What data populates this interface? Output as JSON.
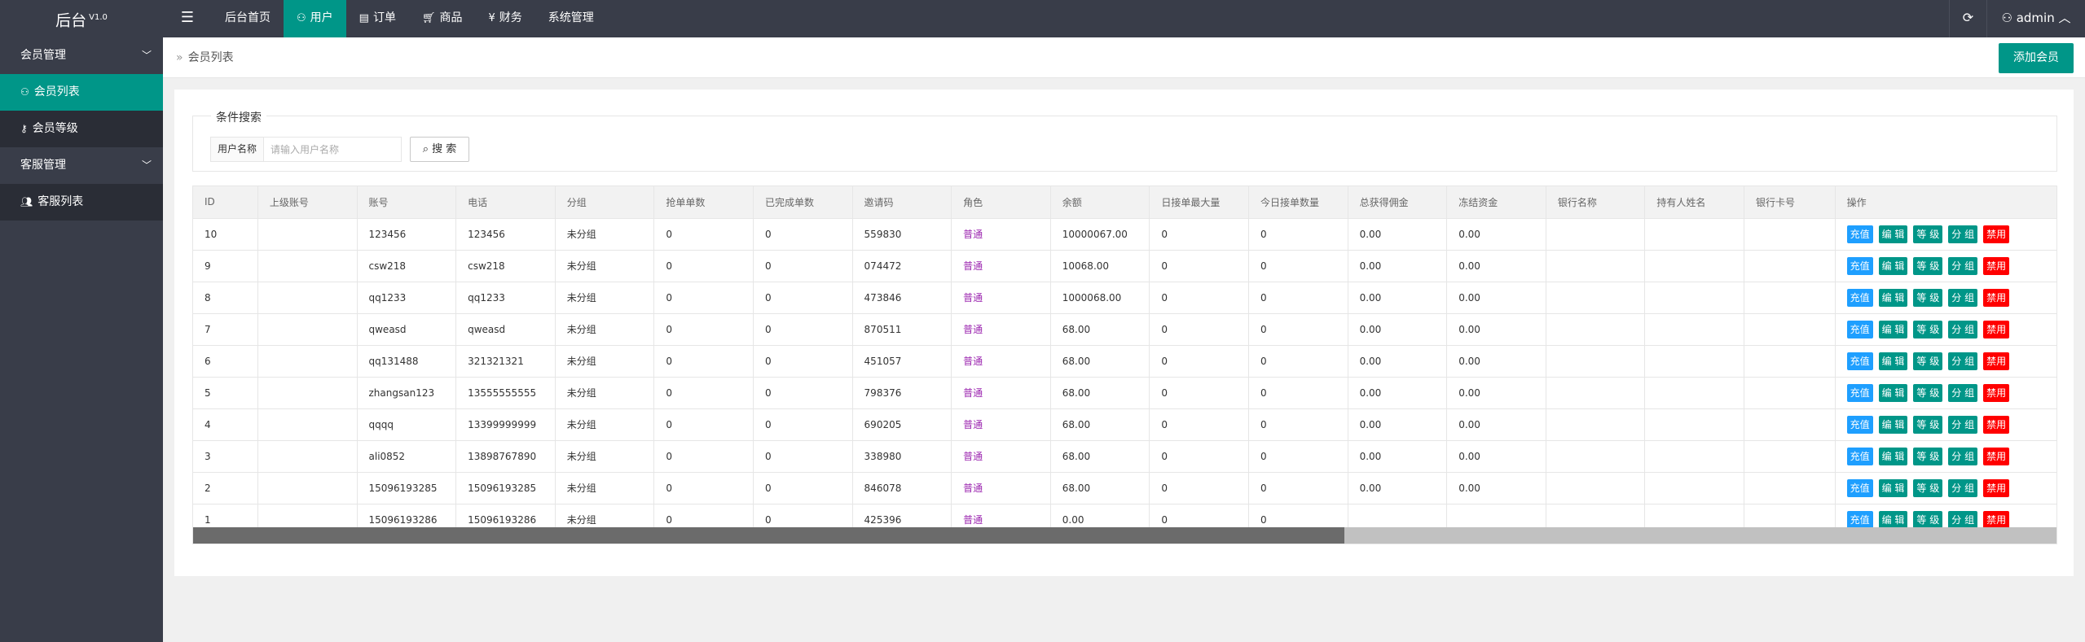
{
  "app": {
    "title": "后台",
    "version": "V1.0"
  },
  "topnav": [
    {
      "label": "后台首页",
      "icon": "",
      "active": false
    },
    {
      "label": "用户",
      "icon": "user-icon",
      "active": true
    },
    {
      "label": "订单",
      "icon": "document-icon",
      "active": false
    },
    {
      "label": "商品",
      "icon": "cart-icon",
      "active": false
    },
    {
      "label": "财务",
      "icon": "yen-icon",
      "active": false
    },
    {
      "label": "系统管理",
      "icon": "",
      "active": false
    }
  ],
  "topright": {
    "user": "admin"
  },
  "sidebar": {
    "groups": [
      {
        "label": "会员管理",
        "items": [
          {
            "label": "会员列表",
            "icon": "user-icon",
            "active": true
          },
          {
            "label": "会员等级",
            "icon": "key-icon",
            "active": false
          }
        ]
      },
      {
        "label": "客服管理",
        "items": [
          {
            "label": "客服列表",
            "icon": "users-icon",
            "active": false
          }
        ]
      }
    ]
  },
  "breadcrumb": {
    "sep": "»",
    "label": "会员列表"
  },
  "toolbar": {
    "add_label": "添加会员"
  },
  "search": {
    "legend": "条件搜索",
    "label": "用户名称",
    "placeholder": "请输入用户名称",
    "button": "搜 索"
  },
  "table": {
    "columns": [
      "ID",
      "上级账号",
      "账号",
      "电话",
      "分组",
      "抢单单数",
      "已完成单数",
      "邀请码",
      "角色",
      "余额",
      "日接单最大量",
      "今日接单数量",
      "总获得佣金",
      "冻结资金",
      "银行名称",
      "持有人姓名",
      "银行卡号",
      "操作"
    ],
    "rows": [
      [
        "10",
        "",
        "123456",
        "123456",
        "未分组",
        "0",
        "0",
        "559830",
        "普通",
        "10000067.00",
        "0",
        "0",
        "0.00",
        "0.00",
        "",
        "",
        ""
      ],
      [
        "9",
        "",
        "csw218",
        "csw218",
        "未分组",
        "0",
        "0",
        "074472",
        "普通",
        "10068.00",
        "0",
        "0",
        "0.00",
        "0.00",
        "",
        "",
        ""
      ],
      [
        "8",
        "",
        "qq1233",
        "qq1233",
        "未分组",
        "0",
        "0",
        "473846",
        "普通",
        "1000068.00",
        "0",
        "0",
        "0.00",
        "0.00",
        "",
        "",
        ""
      ],
      [
        "7",
        "",
        "qweasd",
        "qweasd",
        "未分组",
        "0",
        "0",
        "870511",
        "普通",
        "68.00",
        "0",
        "0",
        "0.00",
        "0.00",
        "",
        "",
        ""
      ],
      [
        "6",
        "",
        "qq131488",
        "321321321",
        "未分组",
        "0",
        "0",
        "451057",
        "普通",
        "68.00",
        "0",
        "0",
        "0.00",
        "0.00",
        "",
        "",
        ""
      ],
      [
        "5",
        "",
        "zhangsan123",
        "13555555555",
        "未分组",
        "0",
        "0",
        "798376",
        "普通",
        "68.00",
        "0",
        "0",
        "0.00",
        "0.00",
        "",
        "",
        ""
      ],
      [
        "4",
        "",
        "qqqq",
        "13399999999",
        "未分组",
        "0",
        "0",
        "690205",
        "普通",
        "68.00",
        "0",
        "0",
        "0.00",
        "0.00",
        "",
        "",
        ""
      ],
      [
        "3",
        "",
        "ali0852",
        "13898767890",
        "未分组",
        "0",
        "0",
        "338980",
        "普通",
        "68.00",
        "0",
        "0",
        "0.00",
        "0.00",
        "",
        "",
        ""
      ],
      [
        "2",
        "",
        "15096193285",
        "15096193285",
        "未分组",
        "0",
        "0",
        "846078",
        "普通",
        "68.00",
        "0",
        "0",
        "0.00",
        "0.00",
        "",
        "",
        ""
      ],
      [
        "1",
        "",
        "15096193286",
        "15096193286",
        "未分组",
        "0",
        "0",
        "425396",
        "普通",
        "0.00",
        "0",
        "0",
        "",
        "",
        "",
        "",
        ""
      ]
    ],
    "actions": [
      {
        "label": "充值",
        "name": "recharge",
        "color": "#1e9fff"
      },
      {
        "label": "编 辑",
        "name": "edit",
        "color": "#009688"
      },
      {
        "label": "等 级",
        "name": "level",
        "color": "#009688"
      },
      {
        "label": "分 组",
        "name": "group",
        "color": "#009688"
      },
      {
        "label": "禁用",
        "name": "disable",
        "color": "#ff0000"
      }
    ]
  },
  "colors": {
    "accent": "#009688",
    "topbar": "#393d49",
    "danger": "#ff0000",
    "info": "#1e9fff",
    "role": "#9c27b0"
  }
}
